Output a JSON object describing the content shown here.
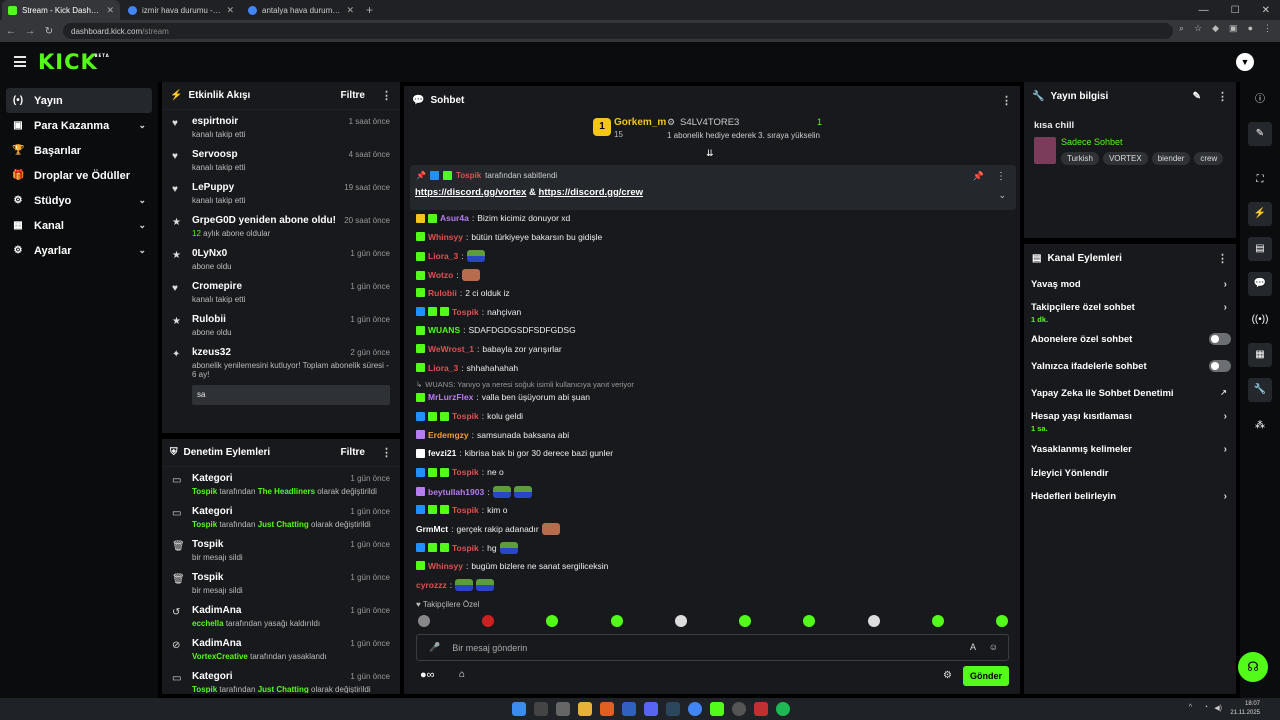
{
  "browser": {
    "tabs": [
      {
        "label": "Stream - Kick Dashboard",
        "color": "#53fc18",
        "active": true
      },
      {
        "label": "izmir hava durumu - Google'da",
        "color": "#4285f4",
        "active": false
      },
      {
        "label": "antalya hava durumu - Google'da",
        "color": "#4285f4",
        "active": false
      }
    ],
    "url_domain": "dashboard.kick.com",
    "url_path": "/stream"
  },
  "header": {
    "logo": "KICK",
    "beta": "BETA"
  },
  "sidebar": {
    "items": [
      {
        "label": "Yayın",
        "icon": "(•)",
        "chev": false,
        "active": true
      },
      {
        "label": "Para Kazanma",
        "icon": "▣",
        "chev": true
      },
      {
        "label": "Başarılar",
        "icon": "🏆",
        "chev": false
      },
      {
        "label": "Droplar ve Ödüller",
        "icon": "🎁",
        "chev": false
      },
      {
        "label": "Stüdyo",
        "icon": "⚙",
        "chev": true
      },
      {
        "label": "Kanal",
        "icon": "▦",
        "chev": true
      },
      {
        "label": "Ayarlar",
        "icon": "⚙",
        "chev": true
      }
    ]
  },
  "activity": {
    "title": "Etkinlik Akışı",
    "filter": "Filtre",
    "items": [
      {
        "name": "espirtnoir",
        "sub": "kanalı takip etti",
        "time": "1 saat önce"
      },
      {
        "name": "Servoosp",
        "sub": "kanalı takip etti",
        "time": "4 saat önce"
      },
      {
        "name": "LePuppy",
        "sub": "kanalı takip etti",
        "time": "19 saat önce"
      },
      {
        "name": "GrpeG0D yeniden abone oldu!",
        "sub_num": "12",
        "sub": "aylık abone oldular",
        "time": "20 saat önce"
      },
      {
        "name": "0LyNx0",
        "sub": "abone oldu",
        "time": "1 gün önce"
      },
      {
        "name": "Cromepire",
        "sub": "kanalı takip etti",
        "time": "1 gün önce"
      },
      {
        "name": "Rulobii",
        "sub": "abone oldu",
        "time": "1 gün önce"
      },
      {
        "name": "kzeus32",
        "sub": "abonelik yenilemesini kutluyor! Toplam abonelik süresi - 6 ay!",
        "time": "2 gün önce",
        "note": "sa"
      }
    ]
  },
  "moderation": {
    "title": "Denetim Eylemleri",
    "filter": "Filtre",
    "items": [
      {
        "name": "Kategori",
        "actor": "Tospik",
        "mid": "tarafından",
        "target": "The Headliners",
        "end": "olarak değiştirildi",
        "time": "1 gün önce"
      },
      {
        "name": "Kategori",
        "actor": "Tospik",
        "mid": "tarafından",
        "target": "Just Chatting",
        "end": "olarak değiştirildi",
        "time": "1 gün önce"
      },
      {
        "name": "Tospik",
        "actor": "",
        "mid": "bir mesajı sildi",
        "target": "",
        "end": "",
        "time": "1 gün önce"
      },
      {
        "name": "Tospik",
        "actor": "",
        "mid": "bir mesajı sildi",
        "target": "",
        "end": "",
        "time": "1 gün önce"
      },
      {
        "name": "KadimAna",
        "actor": "ecchella",
        "mid": "tarafından yasağı kaldırıldı",
        "target": "",
        "end": "",
        "time": "1 gün önce"
      },
      {
        "name": "KadimAna",
        "actor": "VortexCreative",
        "mid": "tarafından yasaklandı",
        "target": "",
        "end": "",
        "time": "1 gün önce"
      },
      {
        "name": "Kategori",
        "actor": "Tospik",
        "mid": "tarafından",
        "target": "Just Chatting",
        "end": "olarak değiştirildi",
        "time": "1 gün önce"
      }
    ]
  },
  "chat": {
    "title": "Sohbet",
    "top_user": "Gorkem_m",
    "top_user_count": "15",
    "top_rank": "1",
    "gifter": "S4LV4TORE3",
    "gifter_count": "1",
    "gifter_sub": "1 abonelik hediye ederek 3. sıraya yükselin",
    "pinned_by": "Tospik",
    "pinned_by_suffix": "tarafından sabitlendi",
    "pinned_link1": "https://discord.gg/vortex",
    "pinned_amp": "&",
    "pinned_link2": "https://discord.gg/crew",
    "messages": [
      {
        "user": "Asur4a",
        "color": "#b67cf2",
        "text": "Bizim kicimiz donuyor xd",
        "badges": [
          "#f5c518",
          "#53fc18"
        ]
      },
      {
        "user": "Whinsyy",
        "color": "#e05050",
        "text": "bütün türkiyeye bakarsın bu gidişle",
        "badges": [
          "#53fc18"
        ]
      },
      {
        "user": "Liora_3",
        "color": "#e05050",
        "text": "",
        "emotes": 1,
        "badges": [
          "#53fc18"
        ]
      },
      {
        "user": "Wotzo",
        "color": "#e05050",
        "text": "",
        "emotes": 1,
        "face": true,
        "badges": [
          "#53fc18"
        ]
      },
      {
        "user": "Rulobii",
        "color": "#e05050",
        "text": "2 ci olduk iz",
        "badges": [
          "#53fc18"
        ]
      },
      {
        "user": "Tospik",
        "color": "#e05050",
        "text": "nahçivan",
        "badges": [
          "#1e90ff",
          "#53fc18",
          "#53fc18"
        ]
      },
      {
        "user": "WUANS",
        "color": "#53fc18",
        "text": "SDAFDGDGSDFSDFGDSG",
        "badges": [
          "#53fc18"
        ]
      },
      {
        "user": "WeWrost_1",
        "color": "#e05050",
        "text": "babayla zor yarışırlar",
        "badges": [
          "#53fc18"
        ]
      },
      {
        "user": "Liora_3",
        "color": "#e05050",
        "text": "shhahahahah",
        "badges": [
          "#53fc18"
        ]
      },
      {
        "user": "MrLurzFlex",
        "color": "#b67cf2",
        "text": "valla ben üşüyorum abi şuan",
        "badges": [
          "#53fc18"
        ],
        "reply": "WUANS: Yanıyo ya neresi soğuk isimli kullanıcıya yanıt veriyor"
      },
      {
        "user": "Tospik",
        "color": "#e05050",
        "text": "kolu geldi",
        "badges": [
          "#1e90ff",
          "#53fc18",
          "#53fc18"
        ]
      },
      {
        "user": "Erdemgzy",
        "color": "#f0a030",
        "text": "samsunada baksana abi",
        "badges": [
          "#b67cf2"
        ]
      },
      {
        "user": "fevzi21",
        "color": "#ffffff",
        "text": "kibrisa bak bi gor 30 derece bazi gunler",
        "badges": [
          "#ffffff"
        ]
      },
      {
        "user": "Tospik",
        "color": "#e05050",
        "text": "ne o",
        "badges": [
          "#1e90ff",
          "#53fc18",
          "#53fc18"
        ]
      },
      {
        "user": "beytullah1903",
        "color": "#b67cf2",
        "text": "",
        "emotes": 2,
        "badges": [
          "#b67cf2"
        ]
      },
      {
        "user": "Tospik",
        "color": "#e05050",
        "text": "kim o",
        "badges": [
          "#1e90ff",
          "#53fc18",
          "#53fc18"
        ]
      },
      {
        "user": "GrmMct",
        "color": "#ffffff",
        "text": "gerçek rakip adanadır",
        "emotes": 1,
        "face": true,
        "badges": []
      },
      {
        "user": "Tospik",
        "color": "#e05050",
        "text": "hg",
        "emotes": 1,
        "badges": [
          "#1e90ff",
          "#53fc18",
          "#53fc18"
        ]
      },
      {
        "user": "Whinsyy",
        "color": "#e05050",
        "text": "bugüm bizlere ne sanat sergiliceksin",
        "badges": [
          "#53fc18"
        ]
      },
      {
        "user": "cyrozzz",
        "color": "#e05050",
        "text": "",
        "emotes": 2,
        "badges": []
      }
    ],
    "followers_only": "Takipçilere Özel",
    "input_placeholder": "Bir mesaj gönderin",
    "send": "Gönder"
  },
  "stream_info": {
    "title": "Yayın bilgisi",
    "stream_title": "kısa chill",
    "category": "Sadece Sohbet",
    "tags": [
      "Turkish",
      "VORTEX",
      "biender",
      "crew"
    ]
  },
  "channel_actions": {
    "title": "Kanal Eylemleri",
    "rows": [
      {
        "label": "Yavaş mod",
        "kind": "arrow"
      },
      {
        "label": "Takipçilere özel sohbet",
        "sub": "1 dk.",
        "kind": "arrow"
      },
      {
        "label": "Abonelere özel sohbet",
        "kind": "toggle"
      },
      {
        "label": "Yalnızca ifadelerle sohbet",
        "kind": "toggle"
      },
      {
        "label": "Yapay Zeka ile Sohbet Denetimi",
        "kind": "ext"
      },
      {
        "label": "Hesap yaşı kısıtlaması",
        "sub": "1 sa.",
        "kind": "arrow"
      },
      {
        "label": "Yasaklanmış kelimeler",
        "kind": "arrow"
      },
      {
        "label": "İzleyici Yönlendir",
        "kind": "none"
      },
      {
        "label": "Hedefleri belirleyin",
        "kind": "arrow"
      }
    ]
  },
  "taskbar": {
    "time": "18:07",
    "date": "21.11.2025"
  }
}
